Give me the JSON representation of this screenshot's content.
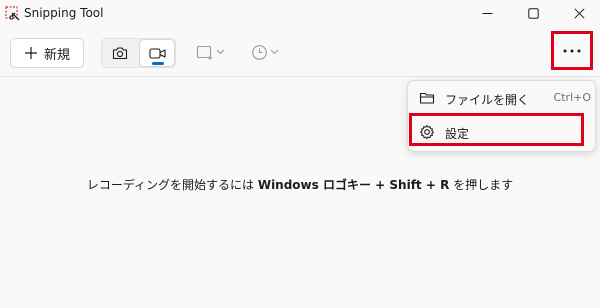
{
  "window": {
    "title": "Snipping Tool"
  },
  "toolbar": {
    "new_label": "新規",
    "icons": {
      "new": "plus-icon",
      "photo_mode": "camera-icon",
      "video_mode": "video-camera-icon",
      "shape": "rectangle-snip-icon",
      "timer": "clock-icon",
      "more": "more-icon"
    }
  },
  "menu": {
    "items": [
      {
        "label": "ファイルを開く",
        "shortcut": "Ctrl+O",
        "icon": "folder-icon"
      },
      {
        "label": "設定",
        "icon": "gear-icon"
      }
    ]
  },
  "main": {
    "message_parts": [
      "レコーディングを開始するには ",
      "Windows ロゴキー",
      " + ",
      "Shift",
      " + ",
      "R",
      " を押します"
    ]
  },
  "colors": {
    "accent": "#0f6cbd",
    "highlight": "#e0001b",
    "background": "#f9f9f9"
  }
}
